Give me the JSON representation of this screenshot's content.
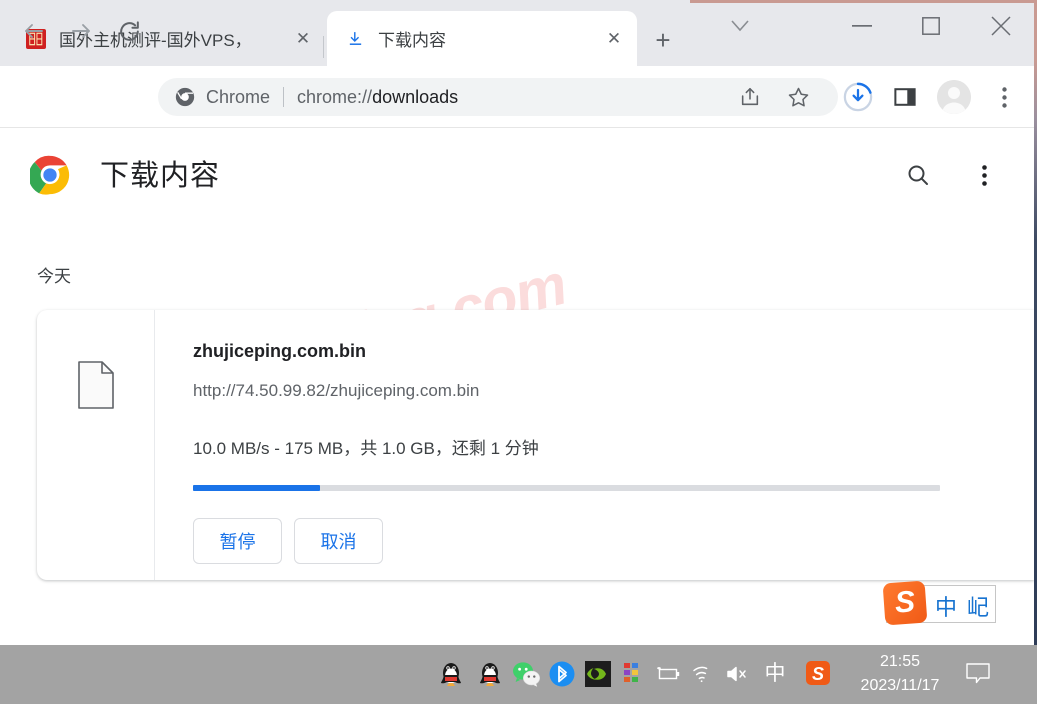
{
  "window": {
    "controls": {
      "tab_search": "chevron-down",
      "minimize": "—",
      "maximize": "□",
      "close": "✕"
    }
  },
  "tabstrip": {
    "tabs": [
      {
        "title": "国外主机测评-国外VPS，",
        "favicon": "site-favicon-red",
        "active": false,
        "close_label": "✕"
      },
      {
        "title": "下载内容",
        "favicon": "download-icon",
        "active": true,
        "close_label": "✕"
      }
    ],
    "new_tab_label": "+"
  },
  "toolbar": {
    "back_icon": "back-arrow-icon",
    "forward_icon": "forward-arrow-icon",
    "reload_icon": "reload-icon",
    "omnibox": {
      "brand": "Chrome",
      "url_scheme": "chrome://",
      "url_rest": "downloads",
      "full_url": "chrome://downloads"
    },
    "right_icons": [
      "share-icon",
      "bookmark-star-icon",
      "download-progress-icon",
      "side-panel-icon",
      "profile-avatar",
      "three-dot-menu-icon"
    ]
  },
  "page": {
    "title": "下载内容",
    "logo": "chrome-logo",
    "search_icon": "search-icon",
    "menu_icon": "three-dot-menu-icon",
    "date_group": "今天",
    "watermark": "zhujiceping.com",
    "download": {
      "file_icon": "generic-file-icon",
      "file_name": "zhujiceping.com.bin",
      "url": "http://74.50.99.82/zhujiceping.com.bin",
      "status": "10.0 MB/s - 175 MB，共 1.0 GB，还剩 1 分钟",
      "progress_percent": 17,
      "buttons": {
        "pause": "暂停",
        "cancel": "取消"
      }
    }
  },
  "ime": {
    "logo_letter": "S",
    "mode": "中",
    "tool": "屺"
  },
  "taskbar": {
    "apps": [
      "qq-icon",
      "qq-icon",
      "wechat-icon",
      "bluetooth-icon",
      "nvidia-icon",
      "color-grid-icon"
    ],
    "tray": [
      "battery-icon",
      "wifi-icon",
      "volume-muted-icon",
      "ime-zh-icon",
      "sogou-icon"
    ],
    "clock_time": "21:55",
    "clock_date": "2023/11/17",
    "notification_icon": "notification-icon"
  },
  "colors": {
    "accent_blue": "#1a73e8",
    "tabstrip_bg": "#e7e8ec",
    "taskbar_bg": "#a3a3a3",
    "watermark_pink": "#fbdcdc",
    "sogou_orange": "#f05a16"
  }
}
